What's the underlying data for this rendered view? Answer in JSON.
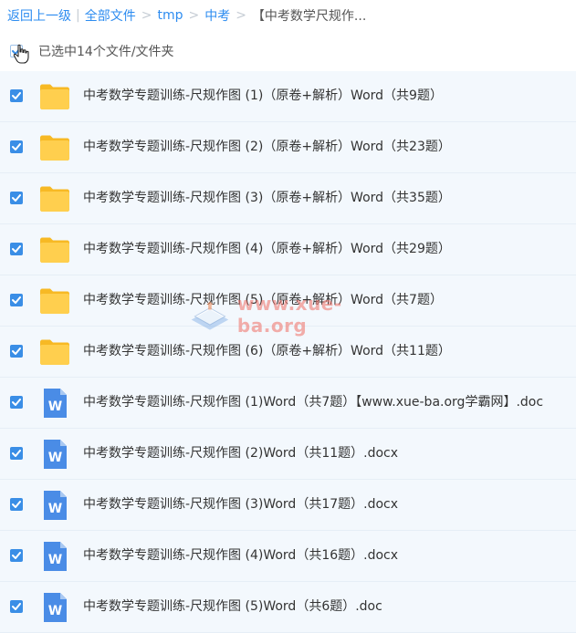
{
  "breadcrumb": {
    "back": "返回上一级",
    "root": "全部文件",
    "sep": ">",
    "bar": "|",
    "path": [
      "tmp",
      "中考"
    ],
    "current": "【中考数学尺规作..."
  },
  "selection": {
    "label": "已选中14个文件/文件夹"
  },
  "files": [
    {
      "type": "folder",
      "name": "中考数学专题训练-尺规作图 (1)（原卷+解析）Word（共9题）"
    },
    {
      "type": "folder",
      "name": "中考数学专题训练-尺规作图 (2)（原卷+解析）Word（共23题）"
    },
    {
      "type": "folder",
      "name": "中考数学专题训练-尺规作图 (3)（原卷+解析）Word（共35题）"
    },
    {
      "type": "folder",
      "name": "中考数学专题训练-尺规作图 (4)（原卷+解析）Word（共29题）"
    },
    {
      "type": "folder",
      "name": "中考数学专题训练-尺规作图 (5)（原卷+解析）Word（共7题）"
    },
    {
      "type": "folder",
      "name": "中考数学专题训练-尺规作图 (6)（原卷+解析）Word（共11题）"
    },
    {
      "type": "word",
      "name": "中考数学专题训练-尺规作图 (1)Word（共7题）【www.xue-ba.org学霸网】.doc"
    },
    {
      "type": "word",
      "name": "中考数学专题训练-尺规作图 (2)Word（共11题）.docx"
    },
    {
      "type": "word",
      "name": "中考数学专题训练-尺规作图 (3)Word（共17题）.docx"
    },
    {
      "type": "word",
      "name": "中考数学专题训练-尺规作图 (4)Word（共16题）.docx"
    },
    {
      "type": "word",
      "name": "中考数学专题训练-尺规作图 (5)Word（共6题）.doc"
    }
  ],
  "icons": {
    "folder": "folder-icon",
    "word": "word-doc-icon",
    "checkbox": "checkmark-icon",
    "cursor": "hand-pointer-icon"
  },
  "colors": {
    "accent": "#2d8cf0",
    "checkbox": "#3a8ee6",
    "folder": "#ffcc4d",
    "word": "#4a8ce6",
    "row_bg": "#f3f8fd"
  },
  "watermark": {
    "text": "www.xue-ba.org"
  }
}
